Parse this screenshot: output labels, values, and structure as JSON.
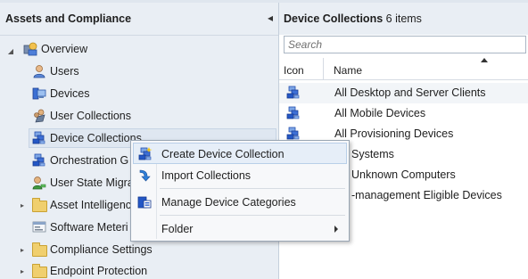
{
  "nav": {
    "title": "Assets and Compliance",
    "collapse_icon": "chevron-left-icon",
    "items": [
      {
        "label": "Overview",
        "icon": "overview-icon"
      },
      {
        "label": "Users",
        "icon": "user-icon"
      },
      {
        "label": "Devices",
        "icon": "devices-icon"
      },
      {
        "label": "User Collections",
        "icon": "user-collection-icon"
      },
      {
        "label": "Device Collections",
        "icon": "device-collection-icon"
      },
      {
        "label": "Orchestration G",
        "icon": "orchestration-icon"
      },
      {
        "label": "User State Migra",
        "icon": "user-state-migration-icon"
      },
      {
        "label": "Asset Intelligenc",
        "icon": "folder-icon"
      },
      {
        "label": "Software Meteri",
        "icon": "software-metering-icon"
      },
      {
        "label": "Compliance Settings",
        "icon": "folder-icon"
      },
      {
        "label": "Endpoint Protection",
        "icon": "folder-icon"
      }
    ]
  },
  "main": {
    "title": "Device Collections",
    "count": "6 items",
    "search_placeholder": "Search",
    "columns": [
      "Icon",
      "Name"
    ],
    "rows": [
      "All Desktop and Server Clients",
      "All Mobile Devices",
      "All Provisioning Devices",
      "Systems",
      "Unknown Computers",
      "-management Eligible Devices"
    ]
  },
  "context_menu": {
    "items": [
      {
        "label": "Create Device Collection",
        "icon": "device-collection-icon"
      },
      {
        "label": "Import Collections",
        "icon": "import-arrow-icon"
      },
      {
        "label": "Manage Device Categories",
        "icon": "device-categories-icon"
      },
      {
        "label": "Folder",
        "icon": "",
        "has_submenu": true
      }
    ]
  },
  "colors": {
    "pane_background": "#e9eef4",
    "selection": "#dfe7f1",
    "menu_hover": "#e6eef8",
    "collection_icon_blue": "#2457c5"
  }
}
